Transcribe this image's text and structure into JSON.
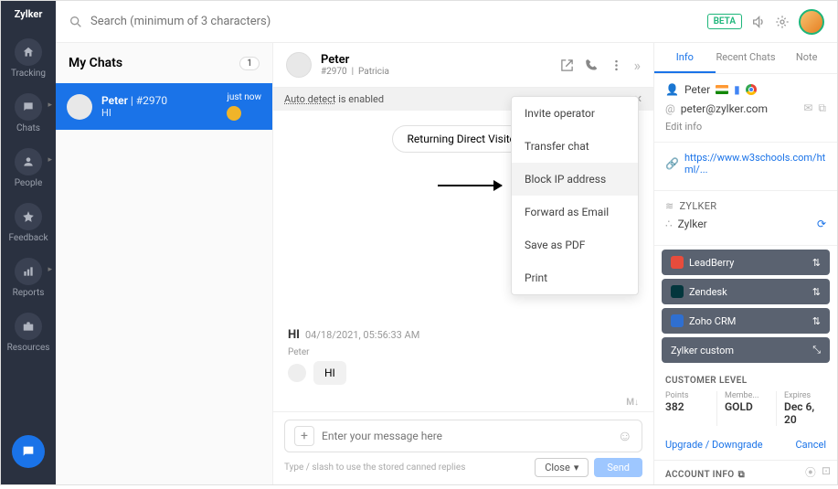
{
  "leftnav": {
    "logo": "Zylker",
    "items": [
      {
        "label": "Tracking"
      },
      {
        "label": "Chats"
      },
      {
        "label": "People"
      },
      {
        "label": "Feedback"
      },
      {
        "label": "Reports"
      },
      {
        "label": "Resources"
      }
    ]
  },
  "search": {
    "placeholder": "Search (minimum of 3 characters)"
  },
  "beta_label": "BETA",
  "mychats": {
    "title": "My Chats",
    "count": "1"
  },
  "chat_item": {
    "name": "Peter",
    "id": "#2970",
    "preview": "HI",
    "time": "just now"
  },
  "chat_header": {
    "name": "Peter",
    "id": "#2970",
    "agent": "Patricia"
  },
  "auto_detect": {
    "prefix": "Auto detect",
    "suffix": " is enabled"
  },
  "visitor_pill": "Returning Direct Visitor",
  "message": {
    "greeting": "HI",
    "timestamp": "04/18/2021, 05:56:33 AM",
    "author": "Peter",
    "text": "HI"
  },
  "md_label": "M↓",
  "composer": {
    "placeholder": "Enter your message here",
    "hint": "Type / slash to use the stored canned replies",
    "close": "Close",
    "send": "Send"
  },
  "dropdown": [
    "Invite operator",
    "Transfer chat",
    "Block IP address",
    "Forward as Email",
    "Save as PDF",
    "Print"
  ],
  "info": {
    "tabs": [
      "Info",
      "Recent Chats",
      "Note"
    ],
    "name": "Peter",
    "email": "peter@zylker.com",
    "edit": "Edit info",
    "url": "https://www.w3schools.com/html/...",
    "org_upper": "ZYLKER",
    "org_name": "Zylker",
    "integrations": [
      {
        "label": "LeadBerry",
        "bg": "#5a6270",
        "sq": "#e74c3c"
      },
      {
        "label": "Zendesk",
        "bg": "#5a6270",
        "sq": "#03363d"
      },
      {
        "label": "Zoho CRM",
        "bg": "#5a6270",
        "sq": "#2f6fd0"
      },
      {
        "label": "Zylker custom",
        "bg": "#5a6270",
        "sq": "#5a6270"
      }
    ],
    "customer_level": "CUSTOMER LEVEL",
    "points_label": "Points",
    "points_val": "382",
    "member_label": "Membe...",
    "member_val": "GOLD",
    "expires_label": "Expires",
    "expires_val": "Dec 6, 20",
    "upgrade": "Upgrade / Downgrade",
    "cancel": "Cancel",
    "account_info": "ACCOUNT INFO"
  }
}
